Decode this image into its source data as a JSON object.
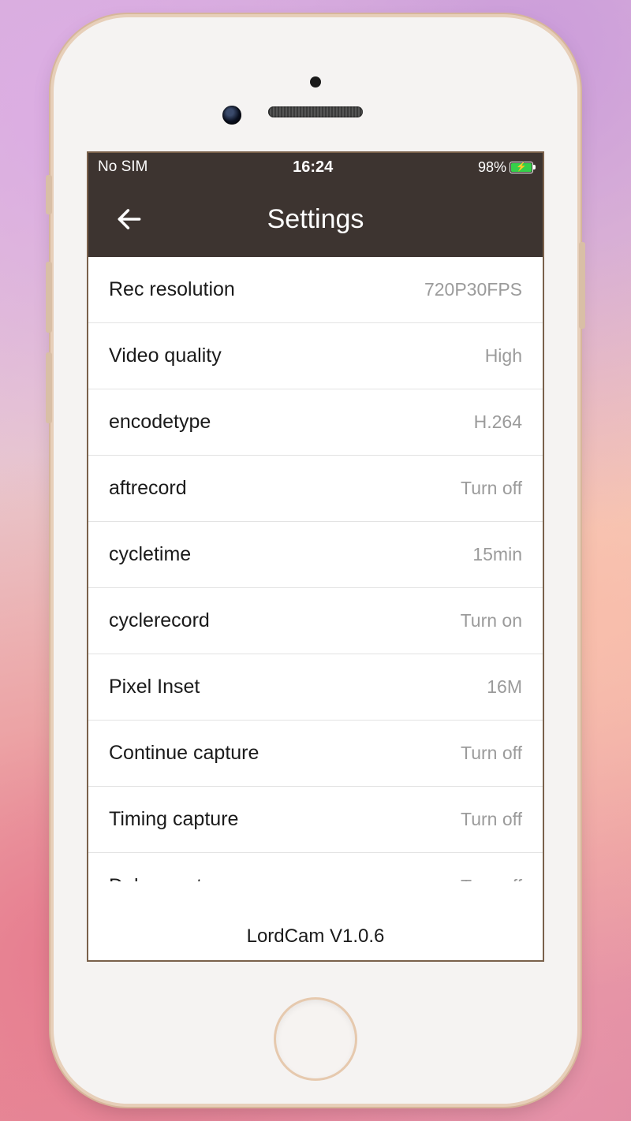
{
  "status": {
    "sim": "No SIM",
    "time": "16:24",
    "battery_pct": "98%"
  },
  "nav": {
    "title": "Settings"
  },
  "settings": [
    {
      "label": "Rec resolution",
      "value": "720P30FPS"
    },
    {
      "label": "Video quality",
      "value": "High"
    },
    {
      "label": "encodetype",
      "value": "H.264"
    },
    {
      "label": "aftrecord",
      "value": "Turn off"
    },
    {
      "label": "cycletime",
      "value": "15min"
    },
    {
      "label": "cyclerecord",
      "value": "Turn on"
    },
    {
      "label": "Pixel Inset",
      "value": "16M"
    },
    {
      "label": "Continue capture",
      "value": "Turn off"
    },
    {
      "label": "Timing capture",
      "value": "Turn off"
    }
  ],
  "settings_partial": {
    "label": "Delay capture",
    "value": "Turn off"
  },
  "footer": {
    "version": "LordCam V1.0.6"
  }
}
